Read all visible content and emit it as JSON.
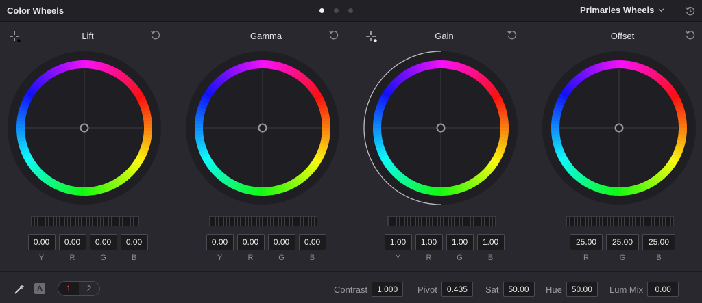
{
  "header": {
    "title": "Color Wheels",
    "page_count": 3,
    "active_page": 1,
    "mode": "Primaries Wheels"
  },
  "icons": {
    "picker": "crosshair-picker-icon",
    "reset": "reset-icon",
    "dropdown": "chevron-down-icon",
    "auto_balance": "auto-balance-icon"
  },
  "wheels": [
    {
      "label": "Lift",
      "has_picker": true,
      "fields": [
        {
          "label": "Y",
          "value": "0.00"
        },
        {
          "label": "R",
          "value": "0.00"
        },
        {
          "label": "G",
          "value": "0.00"
        },
        {
          "label": "B",
          "value": "0.00"
        }
      ]
    },
    {
      "label": "Gamma",
      "has_picker": false,
      "fields": [
        {
          "label": "Y",
          "value": "0.00"
        },
        {
          "label": "R",
          "value": "0.00"
        },
        {
          "label": "G",
          "value": "0.00"
        },
        {
          "label": "B",
          "value": "0.00"
        }
      ]
    },
    {
      "label": "Gain",
      "has_picker": true,
      "fields": [
        {
          "label": "Y",
          "value": "1.00"
        },
        {
          "label": "R",
          "value": "1.00"
        },
        {
          "label": "G",
          "value": "1.00"
        },
        {
          "label": "B",
          "value": "1.00"
        }
      ]
    },
    {
      "label": "Offset",
      "has_picker": false,
      "fields": [
        {
          "label": "R",
          "value": "25.00"
        },
        {
          "label": "G",
          "value": "25.00"
        },
        {
          "label": "B",
          "value": "25.00"
        }
      ]
    }
  ],
  "footer": {
    "badge": "A",
    "pages": [
      "1",
      "2"
    ],
    "active_page_index": 0,
    "controls": [
      {
        "label": "Contrast",
        "value": "1.000"
      },
      {
        "label": "Pivot",
        "value": "0.435"
      },
      {
        "label": "Sat",
        "value": "50.00"
      },
      {
        "label": "Hue",
        "value": "50.00"
      },
      {
        "label": "Lum Mix",
        "value": "0.00"
      }
    ]
  },
  "colors": {
    "accent_red": "#e84a3a",
    "panel_bg": "#28282e",
    "header_bg": "#222226"
  }
}
